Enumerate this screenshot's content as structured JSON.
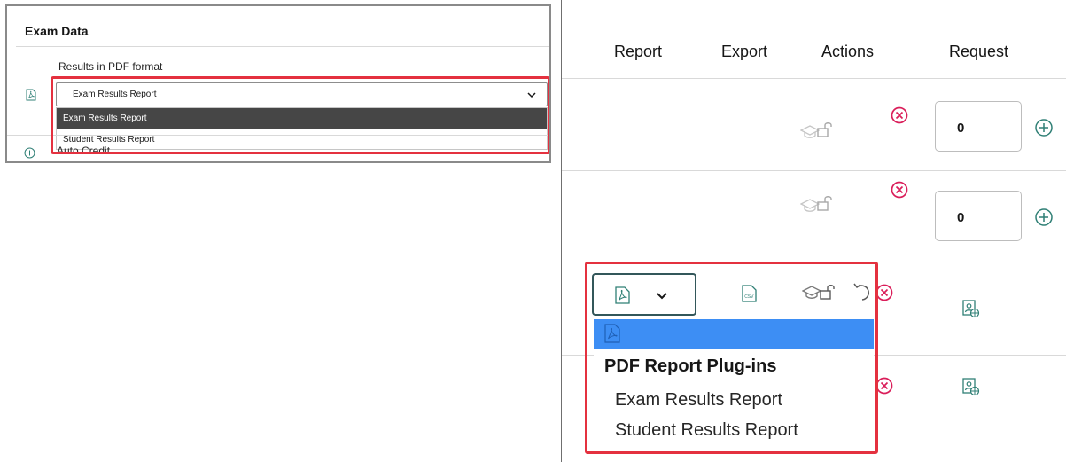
{
  "left_panel": {
    "title": "Exam Data",
    "field_label": "Results in PDF format",
    "select_value": "Exam Results Report",
    "options": [
      "Exam Results Report",
      "Student Results Report"
    ],
    "next_row_label": "Auto Credit"
  },
  "right_panel": {
    "headers": {
      "report": "Report",
      "export": "Export",
      "actions": "Actions",
      "request": "Request"
    },
    "rows": [
      {
        "request_value": "0"
      },
      {
        "request_value": "0"
      }
    ],
    "dropdown": {
      "group_label": "PDF Report Plug-ins",
      "options": [
        "Exam Results Report",
        "Student Results Report"
      ]
    }
  },
  "colors": {
    "highlight_border": "#e4313f",
    "selected_option_bg": "#464646",
    "selected_option_blue": "#3d8ef4",
    "remove_icon": "#da1e5a",
    "icon_teal": "#2f7f75"
  }
}
